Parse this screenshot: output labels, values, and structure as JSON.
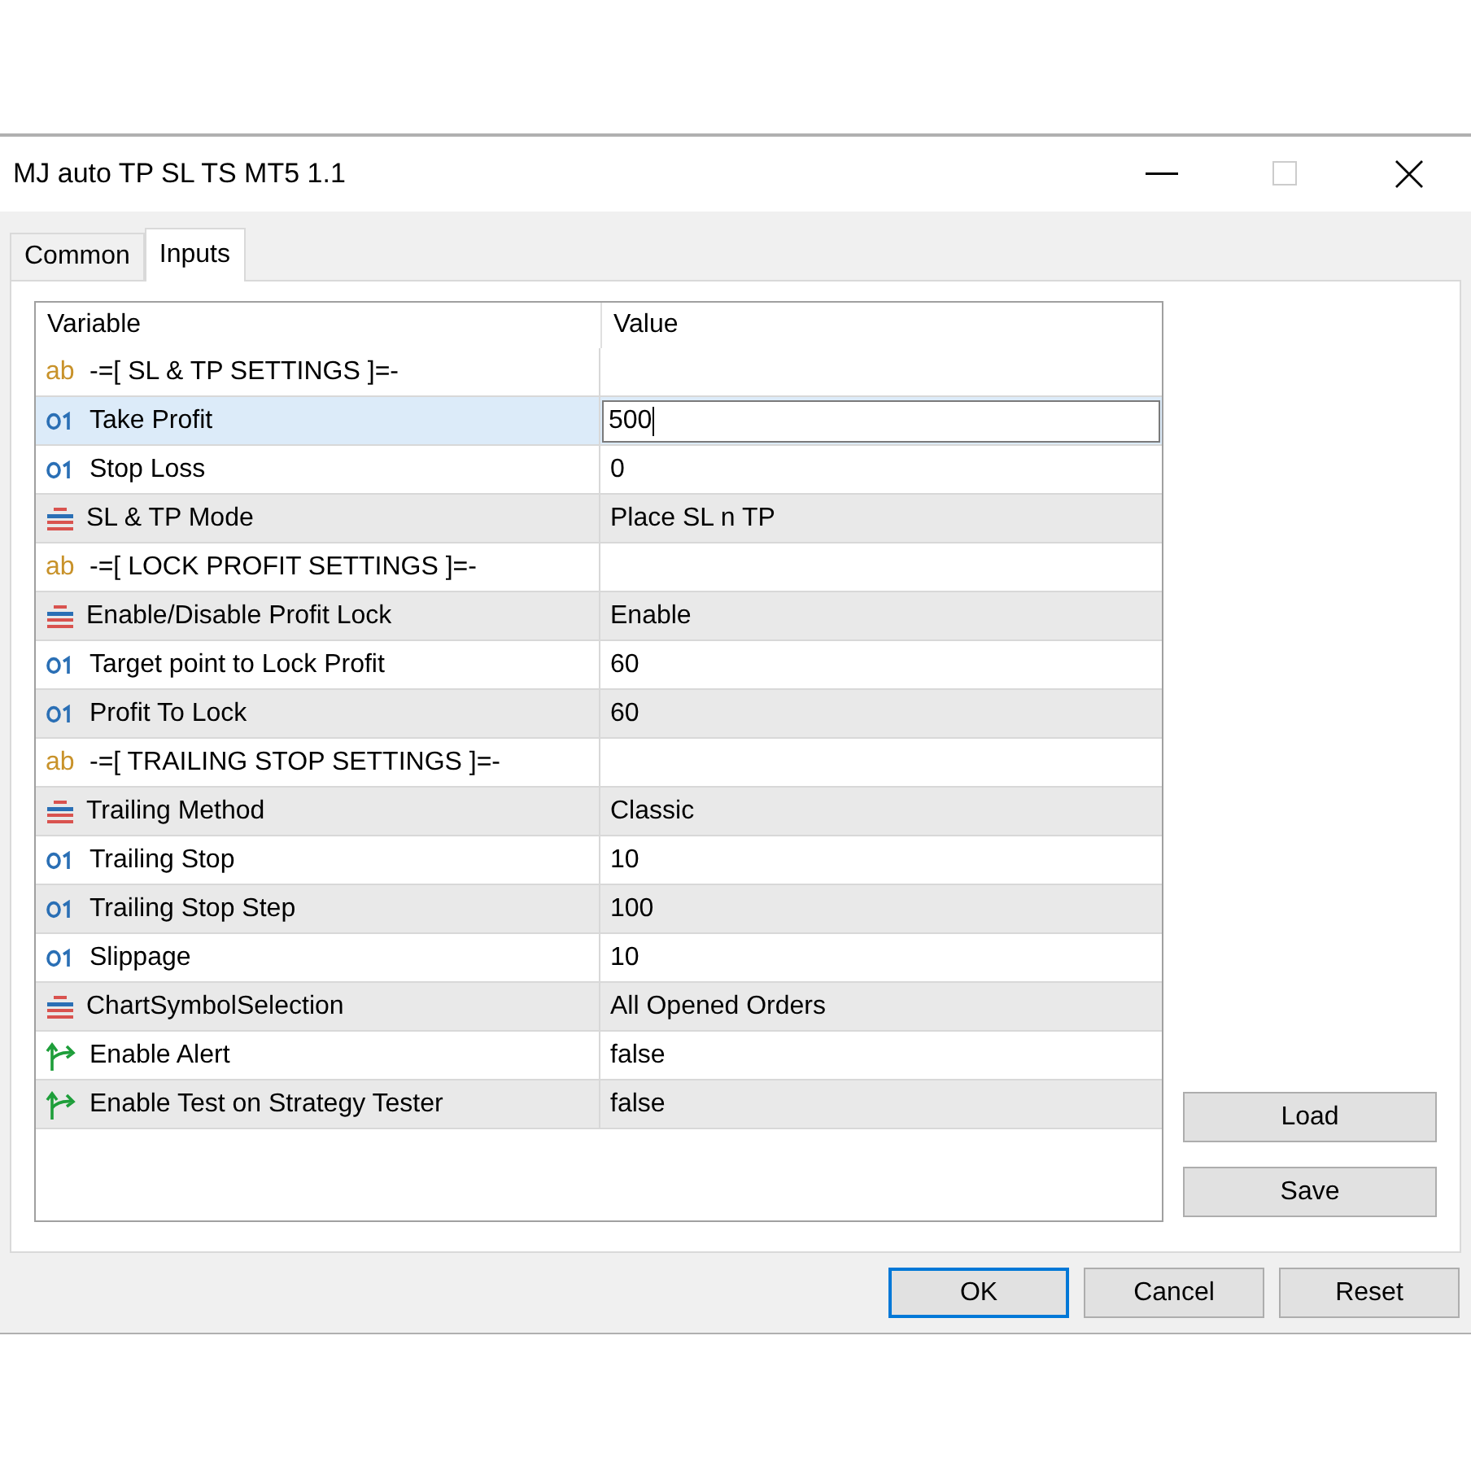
{
  "window": {
    "title": "MJ auto TP SL TS MT5 1.1"
  },
  "tabs": [
    {
      "label": "Common",
      "selected": false
    },
    {
      "label": "Inputs",
      "selected": true
    }
  ],
  "table": {
    "columns": [
      "Variable",
      "Value"
    ],
    "rows": [
      {
        "kind": "string",
        "type_label": "ab",
        "variable": "-=[ SL & TP SETTINGS ]=-",
        "selected": false
      },
      {
        "kind": "int",
        "variable": "Take Profit",
        "value": "500",
        "selected": true
      },
      {
        "kind": "int",
        "variable": "Stop Loss",
        "value": "0",
        "selected": false
      },
      {
        "kind": "enum",
        "variable": "SL & TP Mode",
        "value": "Place SL n TP",
        "selected": false
      },
      {
        "kind": "string",
        "type_label": "ab",
        "variable": "-=[ LOCK PROFIT SETTINGS ]=-",
        "selected": false
      },
      {
        "kind": "enum",
        "variable": "Enable/Disable Profit Lock",
        "value": "Enable",
        "selected": false
      },
      {
        "kind": "int",
        "variable": "Target point to Lock Profit",
        "value": "60",
        "selected": false
      },
      {
        "kind": "int",
        "variable": "Profit To Lock",
        "value": "60",
        "selected": false
      },
      {
        "kind": "string",
        "type_label": "ab",
        "variable": "-=[ TRAILING STOP SETTINGS ]=-",
        "selected": false
      },
      {
        "kind": "enum",
        "variable": "Trailing Method",
        "value": "Classic",
        "selected": false
      },
      {
        "kind": "int",
        "variable": "Trailing Stop",
        "value": "10",
        "selected": false
      },
      {
        "kind": "int",
        "variable": "Trailing Stop Step",
        "value": "100",
        "selected": false
      },
      {
        "kind": "int",
        "variable": "Slippage",
        "value": "10",
        "selected": false
      },
      {
        "kind": "enum",
        "variable": "ChartSymbolSelection",
        "value": "All Opened Orders",
        "selected": false
      },
      {
        "kind": "bool",
        "variable": "Enable Alert",
        "value": "false",
        "selected": false
      },
      {
        "kind": "bool",
        "variable": "Enable Test on Strategy Tester",
        "value": "false",
        "selected": false
      }
    ]
  },
  "side_buttons": [
    "Load",
    "Save"
  ],
  "footer_buttons": [
    {
      "label": "OK",
      "default": true
    },
    {
      "label": "Cancel",
      "default": false
    },
    {
      "label": "Reset",
      "default": false
    }
  ]
}
